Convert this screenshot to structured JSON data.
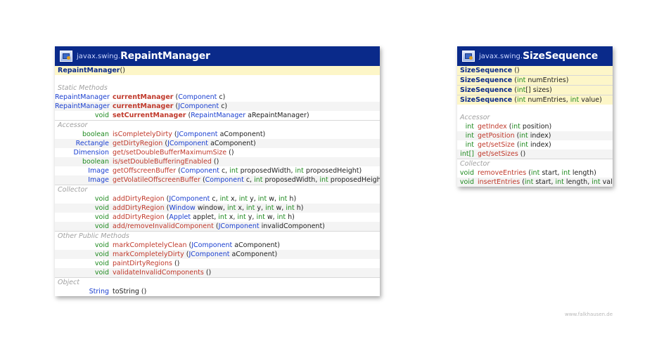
{
  "footer": "www.falkhausen.de",
  "repaint_manager": {
    "package": "javax.swing.",
    "class_name": "RepaintManager",
    "constructor": {
      "name": "RepaintManager",
      "params": " ()"
    },
    "sections": [
      {
        "title": "Static Methods",
        "rows": [
          {
            "type": "RepaintManager",
            "name": "currentManager",
            "bold": true,
            "params": [
              [
                "tx",
                " ("
              ],
              [
                "tk",
                "Component"
              ],
              [
                "tx",
                " c)"
              ]
            ]
          },
          {
            "type": "RepaintManager",
            "name": "currentManager",
            "bold": true,
            "params": [
              [
                "tx",
                " ("
              ],
              [
                "tk",
                "JComponent"
              ],
              [
                "tx",
                " c)"
              ]
            ]
          },
          {
            "type": "void",
            "name": "setCurrentManager",
            "bold": true,
            "params": [
              [
                "tx",
                " ("
              ],
              [
                "tk",
                "RepaintManager"
              ],
              [
                "tx",
                " aRepaintManager)"
              ]
            ]
          }
        ]
      },
      {
        "title": "Accessor",
        "rows": [
          {
            "type": "boolean",
            "name": "isCompletelyDirty",
            "bold": false,
            "params": [
              [
                "tx",
                " ("
              ],
              [
                "tk",
                "JComponent"
              ],
              [
                "tx",
                " aComponent)"
              ]
            ]
          },
          {
            "type": "Rectangle",
            "name": "getDirtyRegion",
            "bold": false,
            "params": [
              [
                "tx",
                " ("
              ],
              [
                "tk",
                "JComponent"
              ],
              [
                "tx",
                " aComponent)"
              ]
            ]
          },
          {
            "type": "Dimension",
            "name": "get/setDoubleBufferMaximumSize",
            "bold": false,
            "params": [
              [
                "tx",
                " ()"
              ]
            ]
          },
          {
            "type": "boolean",
            "name": "is/setDoubleBufferingEnabled",
            "bold": false,
            "params": [
              [
                "tx",
                " ()"
              ]
            ]
          },
          {
            "type": "Image",
            "name": "getOffscreenBuffer",
            "bold": false,
            "params": [
              [
                "tx",
                " ("
              ],
              [
                "tk",
                "Component"
              ],
              [
                "tx",
                " c, "
              ],
              [
                "tp",
                "int"
              ],
              [
                "tx",
                " proposedWidth, "
              ],
              [
                "tp",
                "int"
              ],
              [
                "tx",
                " proposedHeight)"
              ]
            ]
          },
          {
            "type": "Image",
            "name": "getVolatileOffscreenBuffer",
            "bold": false,
            "params": [
              [
                "tx",
                " ("
              ],
              [
                "tk",
                "Component"
              ],
              [
                "tx",
                " c, "
              ],
              [
                "tp",
                "int"
              ],
              [
                "tx",
                " proposedWidth, "
              ],
              [
                "tp",
                "int"
              ],
              [
                "tx",
                " proposedHeight)"
              ]
            ]
          }
        ]
      },
      {
        "title": "Collector",
        "rows": [
          {
            "type": "void",
            "name": "addDirtyRegion",
            "bold": false,
            "params": [
              [
                "tx",
                " ("
              ],
              [
                "tk",
                "JComponent"
              ],
              [
                "tx",
                " c, "
              ],
              [
                "tp",
                "int"
              ],
              [
                "tx",
                " x, "
              ],
              [
                "tp",
                "int"
              ],
              [
                "tx",
                " y, "
              ],
              [
                "tp",
                "int"
              ],
              [
                "tx",
                " w, "
              ],
              [
                "tp",
                "int"
              ],
              [
                "tx",
                " h)"
              ]
            ]
          },
          {
            "type": "void",
            "name": "addDirtyRegion",
            "bold": false,
            "params": [
              [
                "tx",
                " ("
              ],
              [
                "tk",
                "Window"
              ],
              [
                "tx",
                " window, "
              ],
              [
                "tp",
                "int"
              ],
              [
                "tx",
                " x, "
              ],
              [
                "tp",
                "int"
              ],
              [
                "tx",
                " y, "
              ],
              [
                "tp",
                "int"
              ],
              [
                "tx",
                " w, "
              ],
              [
                "tp",
                "int"
              ],
              [
                "tx",
                " h)"
              ]
            ]
          },
          {
            "type": "void",
            "name": "addDirtyRegion",
            "bold": false,
            "params": [
              [
                "tx",
                " ("
              ],
              [
                "tk",
                "Applet"
              ],
              [
                "tx",
                " applet, "
              ],
              [
                "tp",
                "int"
              ],
              [
                "tx",
                " x, "
              ],
              [
                "tp",
                "int"
              ],
              [
                "tx",
                " y, "
              ],
              [
                "tp",
                "int"
              ],
              [
                "tx",
                " w, "
              ],
              [
                "tp",
                "int"
              ],
              [
                "tx",
                " h)"
              ]
            ]
          },
          {
            "type": "void",
            "name": "add/removeInvalidComponent",
            "bold": false,
            "params": [
              [
                "tx",
                " ("
              ],
              [
                "tk",
                "JComponent"
              ],
              [
                "tx",
                " invalidComponent)"
              ]
            ]
          }
        ]
      },
      {
        "title": "Other Public Methods",
        "rows": [
          {
            "type": "void",
            "name": "markCompletelyClean",
            "bold": false,
            "params": [
              [
                "tx",
                " ("
              ],
              [
                "tk",
                "JComponent"
              ],
              [
                "tx",
                " aComponent)"
              ]
            ]
          },
          {
            "type": "void",
            "name": "markCompletelyDirty",
            "bold": false,
            "params": [
              [
                "tx",
                " ("
              ],
              [
                "tk",
                "JComponent"
              ],
              [
                "tx",
                " aComponent)"
              ]
            ]
          },
          {
            "type": "void",
            "name": "paintDirtyRegions",
            "bold": false,
            "params": [
              [
                "tx",
                " ()"
              ]
            ]
          },
          {
            "type": "void",
            "name": "validateInvalidComponents",
            "bold": false,
            "params": [
              [
                "tx",
                " ()"
              ]
            ]
          }
        ]
      },
      {
        "title": "Object",
        "rows": [
          {
            "type": "String",
            "name": "toString",
            "bold": false,
            "plain": true,
            "params": [
              [
                "tx",
                " ()"
              ]
            ]
          }
        ]
      }
    ]
  },
  "size_sequence": {
    "package": "javax.swing.",
    "class_name": "SizeSequence",
    "constructors": [
      [
        [
          "tx",
          " ()"
        ]
      ],
      [
        [
          "tx",
          " ("
        ],
        [
          "tp",
          "int"
        ],
        [
          "tx",
          " numEntries)"
        ]
      ],
      [
        [
          "tx",
          " ("
        ],
        [
          "tp",
          "int"
        ],
        [
          "tx",
          "[] sizes)"
        ]
      ],
      [
        [
          "tx",
          " ("
        ],
        [
          "tp",
          "int"
        ],
        [
          "tx",
          " numEntries, "
        ],
        [
          "tp",
          "int"
        ],
        [
          "tx",
          " value)"
        ]
      ]
    ],
    "sections": [
      {
        "title": "Accessor",
        "rows": [
          {
            "type": "int",
            "name": "getIndex",
            "bold": false,
            "params": [
              [
                "tx",
                " ("
              ],
              [
                "tp",
                "int"
              ],
              [
                "tx",
                " position)"
              ]
            ]
          },
          {
            "type": "int",
            "name": "getPosition",
            "bold": false,
            "params": [
              [
                "tx",
                " ("
              ],
              [
                "tp",
                "int"
              ],
              [
                "tx",
                " index)"
              ]
            ]
          },
          {
            "type": "int",
            "name": "get/setSize",
            "bold": false,
            "params": [
              [
                "tx",
                " ("
              ],
              [
                "tp",
                "int"
              ],
              [
                "tx",
                " index)"
              ]
            ]
          },
          {
            "type": "int[]",
            "name": "get/setSizes",
            "bold": false,
            "params": [
              [
                "tx",
                " ()"
              ]
            ]
          }
        ]
      },
      {
        "title": "Collector",
        "rows": [
          {
            "type": "void",
            "name": "removeEntries",
            "bold": false,
            "params": [
              [
                "tx",
                " ("
              ],
              [
                "tp",
                "int"
              ],
              [
                "tx",
                " start, "
              ],
              [
                "tp",
                "int"
              ],
              [
                "tx",
                " length)"
              ]
            ]
          },
          {
            "type": "void",
            "name": "insertEntries",
            "bold": false,
            "params": [
              [
                "tx",
                " ("
              ],
              [
                "tp",
                "int"
              ],
              [
                "tx",
                " start, "
              ],
              [
                "tp",
                "int"
              ],
              [
                "tx",
                " length, "
              ],
              [
                "tp",
                "int"
              ],
              [
                "tx",
                " value)"
              ]
            ]
          }
        ]
      }
    ]
  }
}
